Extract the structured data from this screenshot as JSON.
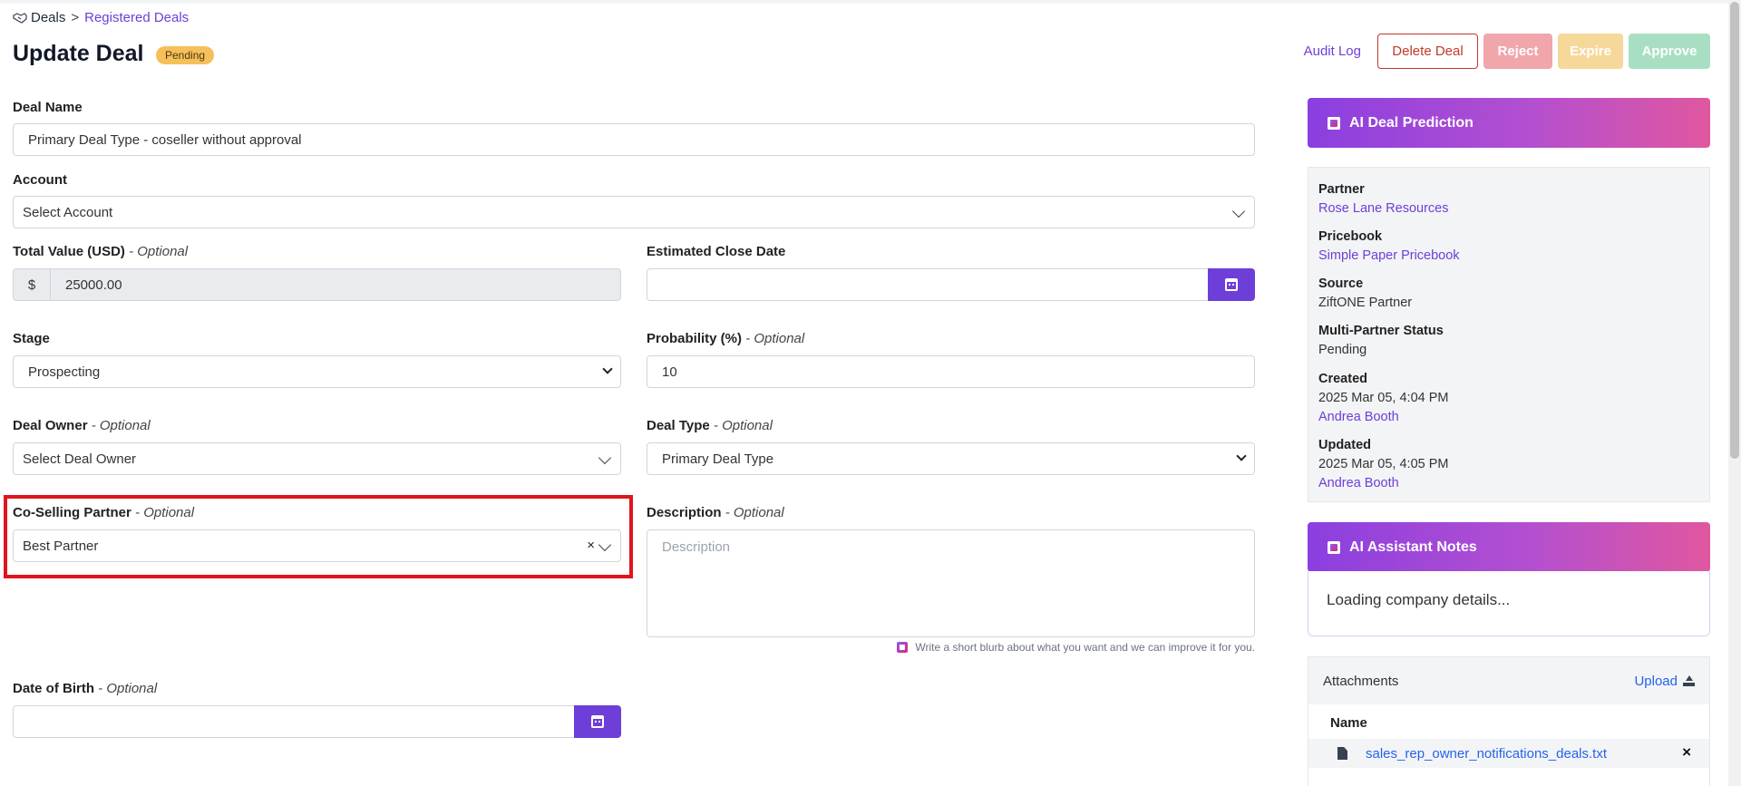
{
  "breadcrumb": {
    "root": "Deals",
    "separator": ">",
    "current": "Registered Deals"
  },
  "page": {
    "title": "Update Deal",
    "status": "Pending"
  },
  "actions": {
    "audit_log": "Audit Log",
    "delete": "Delete Deal",
    "reject": "Reject",
    "expire": "Expire",
    "approve": "Approve"
  },
  "form": {
    "optional_suffix": "- Optional",
    "deal_name": {
      "label": "Deal Name",
      "value": "Primary Deal Type - coseller without approval"
    },
    "account": {
      "label": "Account",
      "value": "Select Account"
    },
    "total_value": {
      "label": "Total Value (USD)",
      "currency": "$",
      "value": "25000.00"
    },
    "close_date": {
      "label": "Estimated Close Date",
      "value": ""
    },
    "stage": {
      "label": "Stage",
      "value": "Prospecting"
    },
    "probability": {
      "label": "Probability (%)",
      "value": "10"
    },
    "deal_owner": {
      "label": "Deal Owner",
      "value": "Select Deal Owner"
    },
    "deal_type": {
      "label": "Deal Type",
      "value": "Primary Deal Type"
    },
    "co_selling_partner": {
      "label": "Co-Selling Partner",
      "value": "Best Partner",
      "clear": "×"
    },
    "description": {
      "label": "Description",
      "placeholder": "Description",
      "hint": "Write a short blurb about what you want and we can improve it for you."
    },
    "date_of_birth": {
      "label": "Date of Birth",
      "value": ""
    }
  },
  "prediction": {
    "header": "AI Deal Prediction",
    "partner": {
      "label": "Partner",
      "value": "Rose Lane Resources"
    },
    "pricebook": {
      "label": "Pricebook",
      "value": "Simple Paper Pricebook"
    },
    "source": {
      "label": "Source",
      "value": "ZiftONE Partner"
    },
    "multi_partner_status": {
      "label": "Multi-Partner Status",
      "value": "Pending"
    },
    "created": {
      "label": "Created",
      "date": "2025 Mar 05, 4:04 PM",
      "user": "Andrea Booth"
    },
    "updated": {
      "label": "Updated",
      "date": "2025 Mar 05, 4:05 PM",
      "user": "Andrea Booth"
    }
  },
  "notes": {
    "header": "AI Assistant Notes",
    "body": "Loading company details..."
  },
  "attachments": {
    "title": "Attachments",
    "upload": "Upload",
    "column": "Name",
    "files": [
      "sales_rep_owner_notifications_deals.txt"
    ],
    "remove": "×"
  },
  "colors": {
    "accent": "#6d3fd8",
    "danger": "#c0392b",
    "badge": "#f5c05a",
    "highlight": "#e0141e"
  },
  "icons": [
    "handshake-icon",
    "calendar-icon",
    "chevron-down-icon",
    "close-icon",
    "ai-logo-icon",
    "upload-icon",
    "file-icon"
  ]
}
